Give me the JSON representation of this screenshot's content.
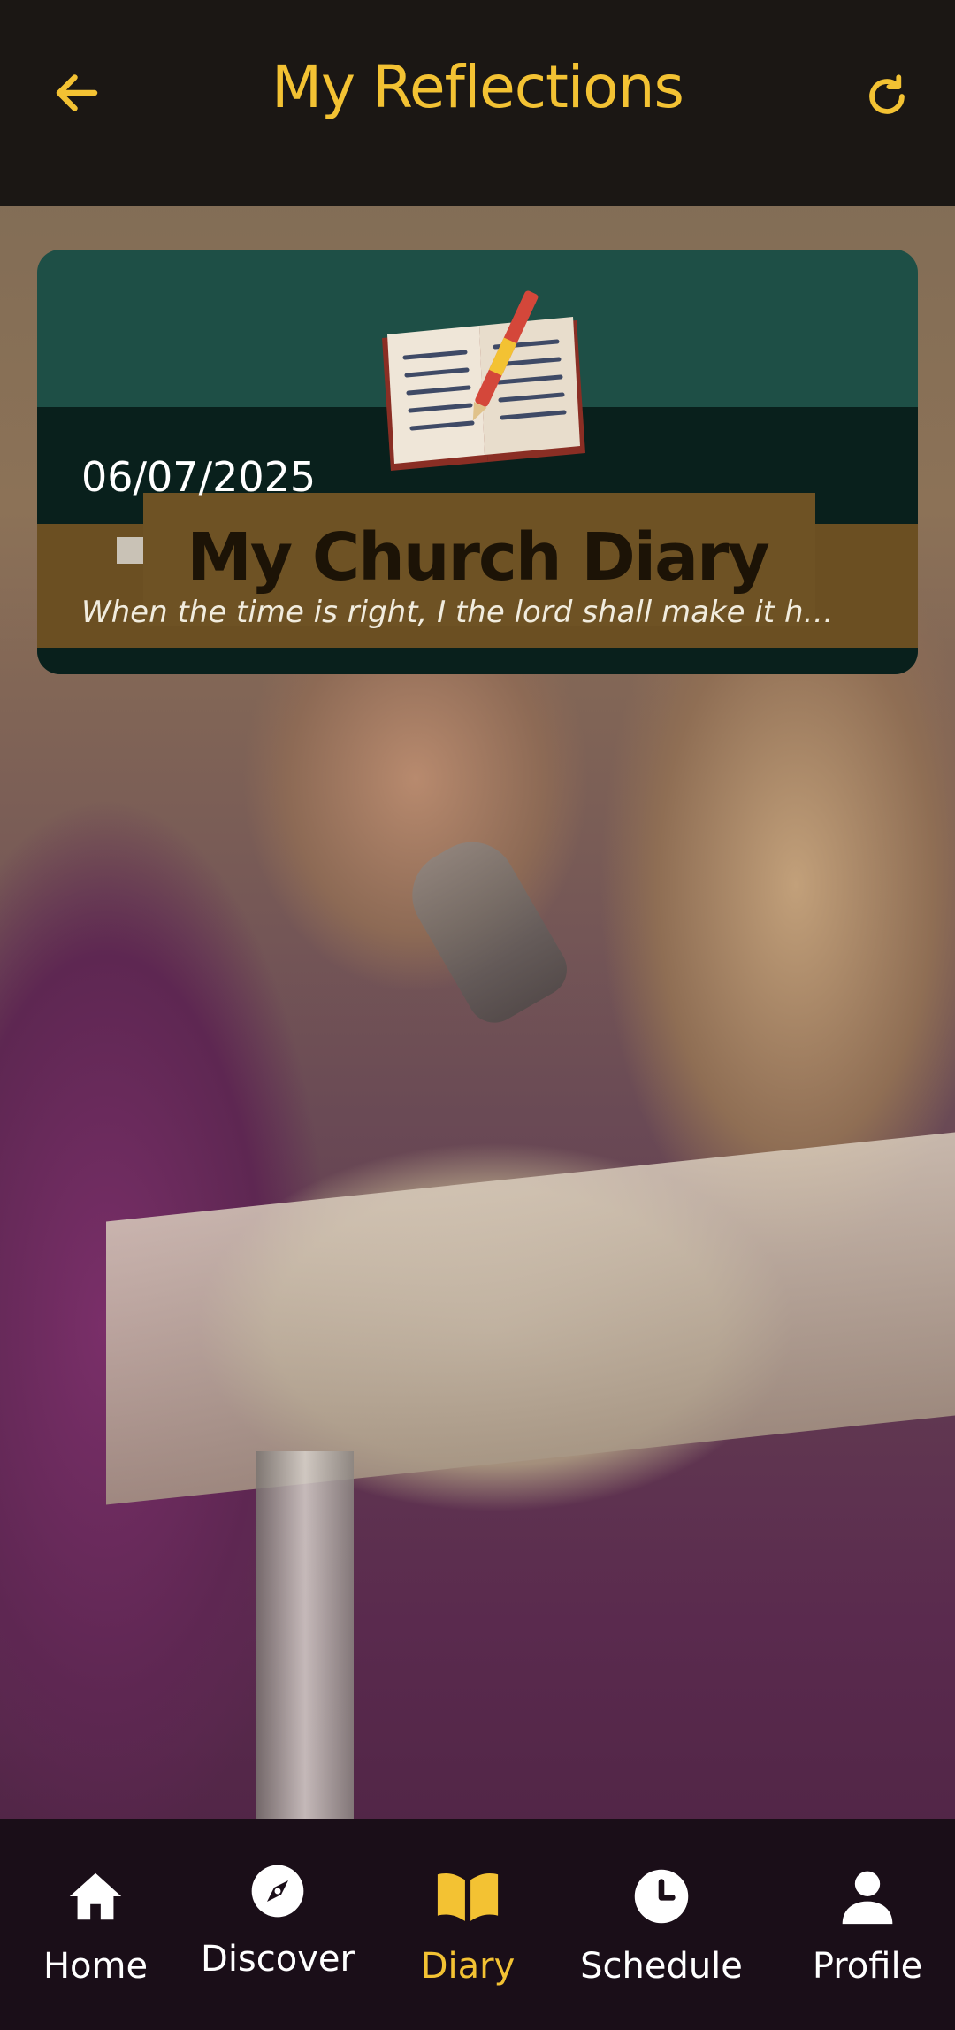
{
  "header": {
    "title": "My Reflections",
    "back_icon": "arrow-left-icon",
    "refresh_icon": "refresh-icon"
  },
  "entries": [
    {
      "date": "06/07/2025",
      "banner_title": "My Church Diary",
      "excerpt": "When the time is right, I the lord shall make it h…"
    }
  ],
  "nav": {
    "items": [
      {
        "label": "Home",
        "icon": "home-icon"
      },
      {
        "label": "Discover",
        "icon": "compass-icon"
      },
      {
        "label": "Diary",
        "icon": "book-icon",
        "active": true
      },
      {
        "label": "Schedule",
        "icon": "clock-icon"
      },
      {
        "label": "Profile",
        "icon": "person-icon"
      }
    ]
  },
  "colors": {
    "accent": "#f3c233",
    "header_bg": "#1b1714",
    "nav_bg": "#1a0e18",
    "card_bg": "#1e4f46"
  }
}
